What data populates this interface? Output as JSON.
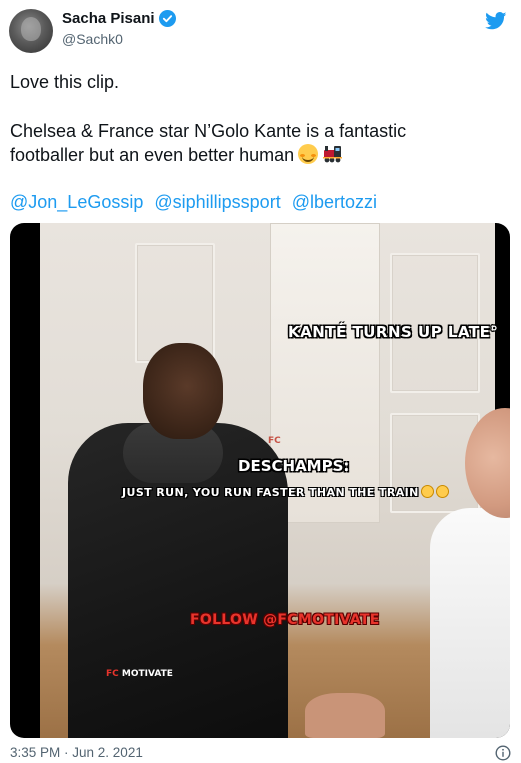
{
  "author": {
    "display_name": "Sacha Pisani",
    "handle": "@Sachk0",
    "verified": true,
    "avatar": "profile-photo"
  },
  "tweet": {
    "line1": "Love this clip.",
    "line2a": "Chelsea & France star N’Golo Kante is a fantastic",
    "line2b": "footballer but an even better human",
    "emojis": [
      "smiling-face-with-blush-icon",
      "steam-locomotive-icon"
    ],
    "mentions": [
      "@Jon_LeGossip",
      "@siphillipssport",
      "@lbertozzi"
    ]
  },
  "video": {
    "caption_top": "KANTÉ TURNS UP LATE°",
    "watermark_top": "FC",
    "speaker": "DESCHAMPS:",
    "quote": "JUST RUN, YOU RUN FASTER THAN THE TRAIN",
    "quote_emojis": [
      "laughing-face-icon",
      "winking-face-icon"
    ],
    "follow_cta": "FOLLOW @FCMOTIVATE",
    "watermark_bottom_prefix": "FC",
    "watermark_bottom_suffix": "MOTIVATE"
  },
  "footer": {
    "timestamp": "3:35 PM · Jun 2. 2021",
    "info_icon": "info-icon"
  },
  "colors": {
    "link": "#1d9bf0",
    "text": "#0f1419",
    "muted": "#536471",
    "verified": "#1d9bf0",
    "cta_red": "#e8342c"
  }
}
